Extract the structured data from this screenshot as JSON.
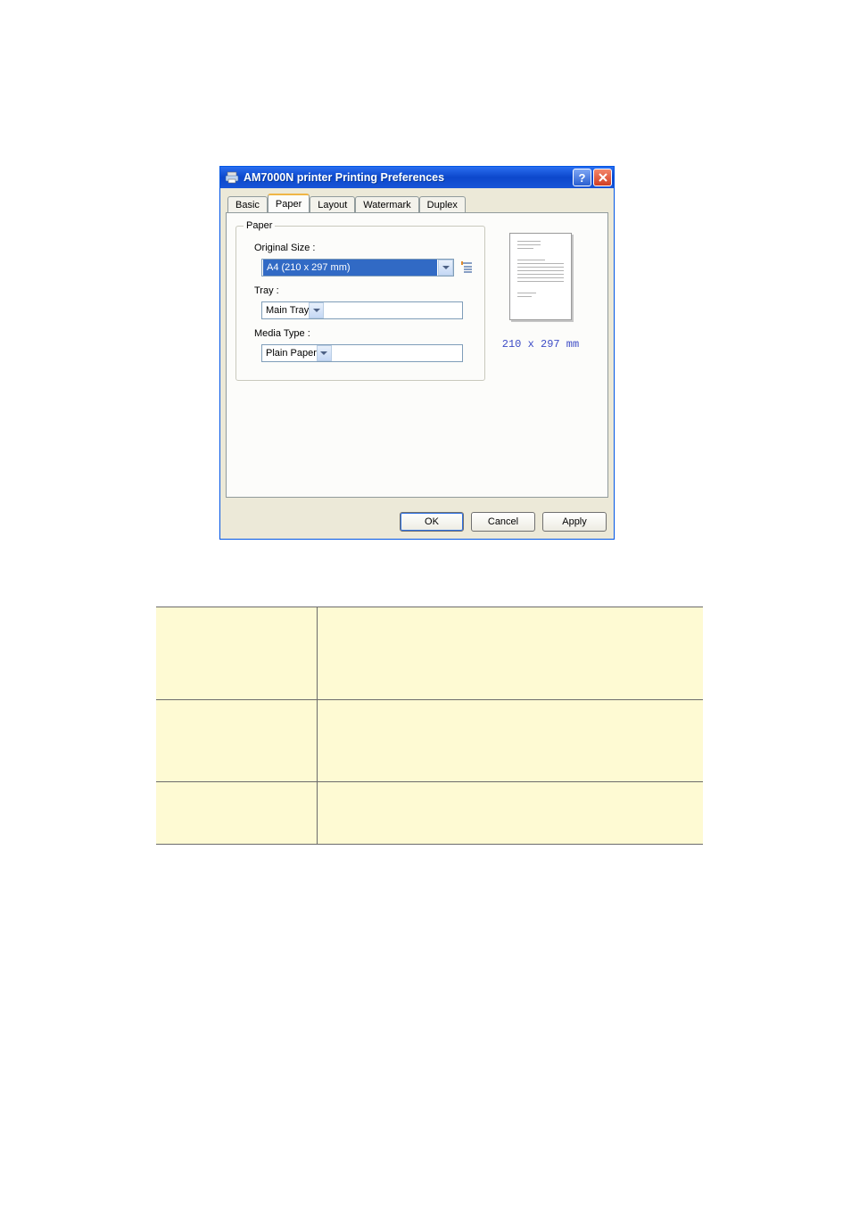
{
  "dialog": {
    "title": "AM7000N printer Printing Preferences",
    "tabs": {
      "basic": "Basic",
      "paper": "Paper",
      "layout": "Layout",
      "watermark": "Watermark",
      "duplex": "Duplex"
    },
    "group_legend": "Paper",
    "labels": {
      "original_size": "Original Size :",
      "tray": "Tray :",
      "media_type": "Media Type :"
    },
    "values": {
      "original_size": "A4 (210 x 297 mm)",
      "tray": "Main Tray",
      "media_type": "Plain Paper"
    },
    "preview_dim": "210 x 297 mm",
    "buttons": {
      "ok": "OK",
      "cancel": "Cancel",
      "apply": "Apply"
    }
  }
}
